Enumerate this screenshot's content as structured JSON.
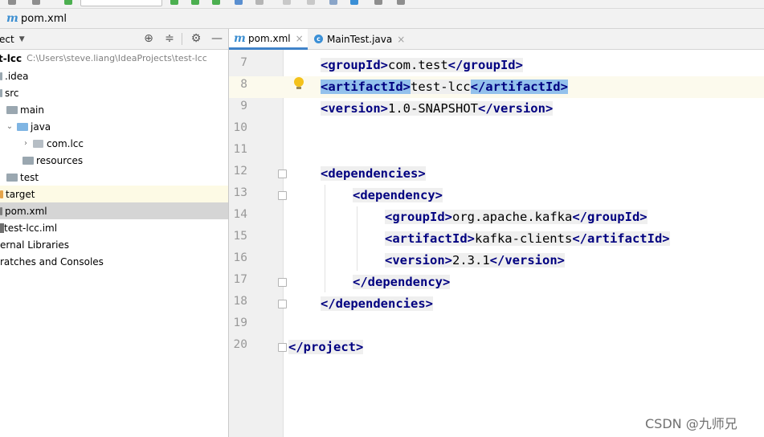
{
  "navbar": {
    "file": "pom.xml"
  },
  "project_panel": {
    "title": "ect",
    "tree": [
      {
        "label": "t-lcc",
        "path": "C:\\Users\\steve.liang\\IdeaProjects\\test-lcc"
      },
      {
        "label": ".idea"
      },
      {
        "label": "src"
      },
      {
        "label": "main"
      },
      {
        "label": "java"
      },
      {
        "label": "com.lcc"
      },
      {
        "label": "resources"
      },
      {
        "label": "test"
      },
      {
        "label": "target"
      },
      {
        "label": "pom.xml"
      },
      {
        "label": "test-lcc.iml"
      },
      {
        "label": "ernal Libraries"
      },
      {
        "label": "ratches and Consoles"
      }
    ]
  },
  "tabs": [
    {
      "label": "pom.xml",
      "close": "×"
    },
    {
      "label": "MainTest.java",
      "close": "×"
    }
  ],
  "editor": {
    "line_numbers": [
      "7",
      "8",
      "9",
      "10",
      "11",
      "12",
      "13",
      "14",
      "15",
      "16",
      "17",
      "18",
      "19",
      "20"
    ],
    "lines": {
      "l7": {
        "open": "<groupId>",
        "text": "com.test",
        "close": "</groupId>"
      },
      "l8": {
        "open": "<artifactId>",
        "text": "test-lcc",
        "close": "</artifactId>"
      },
      "l9": {
        "open": "<version>",
        "text": "1.0-SNAPSHOT",
        "close": "</version>"
      },
      "l12": {
        "open": "<dependencies>"
      },
      "l13": {
        "open": "<dependency>"
      },
      "l14": {
        "open": "<groupId>",
        "text": "org.apache.kafka",
        "close": "</groupId>"
      },
      "l15": {
        "open": "<artifactId>",
        "text": "kafka-clients",
        "close": "</artifactId>"
      },
      "l16": {
        "open": "<version>",
        "text": "2.3.1",
        "close": "</version>"
      },
      "l17": {
        "close": "</dependency>"
      },
      "l18": {
        "close": "</dependencies>"
      },
      "l20": {
        "close": "</project>"
      }
    }
  },
  "watermark": "CSDN @九师兄",
  "colors": {
    "tag": "#000080",
    "match_highlight": "#93c1ec",
    "selected_row": "#d5d5d5",
    "accent": "#4083c9"
  },
  "icons": [
    "maven-m-icon",
    "class-c-icon",
    "folder-icon",
    "bulb-icon",
    "target-icon",
    "collapse-icon",
    "gear-icon",
    "minimize-icon"
  ]
}
